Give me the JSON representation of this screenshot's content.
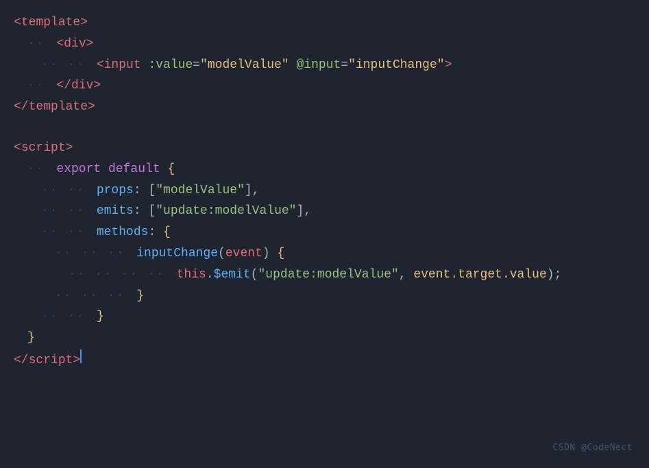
{
  "watermark": "CSDN @CodeNect",
  "lines": [
    {
      "id": "l1",
      "type": "template_open"
    },
    {
      "id": "l2",
      "type": "div_open"
    },
    {
      "id": "l3",
      "type": "input_tag"
    },
    {
      "id": "l4",
      "type": "div_close"
    },
    {
      "id": "l5",
      "type": "template_close"
    },
    {
      "id": "l6",
      "type": "empty"
    },
    {
      "id": "l7",
      "type": "script_open"
    },
    {
      "id": "l8",
      "type": "export_default"
    },
    {
      "id": "l9",
      "type": "props"
    },
    {
      "id": "l10",
      "type": "emits"
    },
    {
      "id": "l11",
      "type": "methods"
    },
    {
      "id": "l12",
      "type": "inputChange_def"
    },
    {
      "id": "l13",
      "type": "this_emit"
    },
    {
      "id": "l14",
      "type": "inner_close"
    },
    {
      "id": "l15",
      "type": "methods_close"
    },
    {
      "id": "l16",
      "type": "obj_close"
    },
    {
      "id": "l17",
      "type": "script_close"
    }
  ]
}
